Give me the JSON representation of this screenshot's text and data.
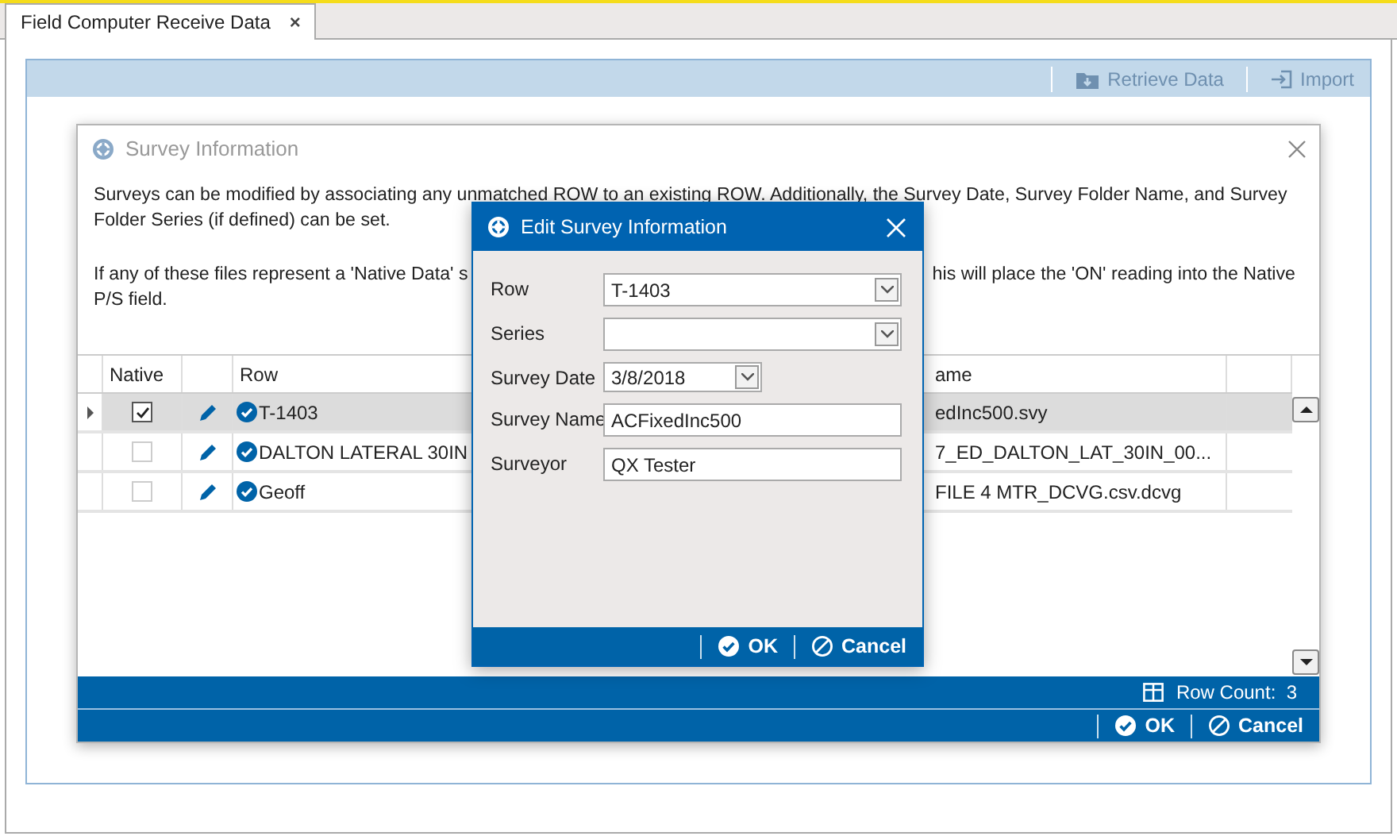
{
  "tabs": [
    {
      "label": "Field Computer Receive Data",
      "selected": true,
      "close": "×"
    }
  ],
  "toolbar": {
    "buttons": [
      {
        "kind": "retrieve",
        "label": "Retrieve Data",
        "disabled": true
      },
      {
        "kind": "import",
        "label": "Import",
        "disabled": true
      }
    ]
  },
  "survey_dialog": {
    "title": "Survey Information",
    "active": false,
    "intro": [
      "Surveys can be modified by associating any unmatched ROW to an existing ROW. Additionally, the Survey Date, Survey Folder Name, and Survey",
      "Folder Series (if defined) can be set."
    ],
    "native_note_left": [
      "If any of these files represent a 'Native Data' s",
      "P/S field."
    ],
    "native_note_right": "his will place the 'ON' reading into the Native",
    "table": {
      "columns": {
        "native": "Native",
        "row": "Row",
        "column_4": "ame"
      },
      "rows": [
        {
          "selected": true,
          "native": true,
          "row": "T-1403",
          "column_4": "edInc500.svy"
        },
        {
          "selected": false,
          "native": false,
          "row": "DALTON LATERAL 30IN",
          "column_4": "7_ED_DALTON_LAT_30IN_00..."
        },
        {
          "selected": false,
          "native": false,
          "row": "Geoff",
          "column_4": "FILE 4 MTR_DCVG.csv.dcvg"
        }
      ]
    },
    "row_count": "Row Count:  3",
    "buttons": [
      {
        "kind": "ok",
        "label": "OK"
      },
      {
        "kind": "cancel",
        "label": "Cancel"
      }
    ]
  },
  "edit_dialog": {
    "title": "Edit Survey Information",
    "fields": [
      {
        "kind": "dropdown",
        "label": "Row",
        "value": "T-1403"
      },
      {
        "kind": "dropdown",
        "label": "Series"
      },
      {
        "kind": "date",
        "label": "Survey Date",
        "value": "3/8/2018"
      },
      {
        "kind": "text",
        "label": "Survey Name",
        "value": "ACFixedInc500"
      },
      {
        "kind": "text",
        "label": "Surveyor",
        "value": "QX Tester"
      }
    ],
    "buttons": [
      {
        "kind": "ok",
        "label": "OK"
      },
      {
        "kind": "cancel",
        "label": "Cancel"
      }
    ]
  }
}
